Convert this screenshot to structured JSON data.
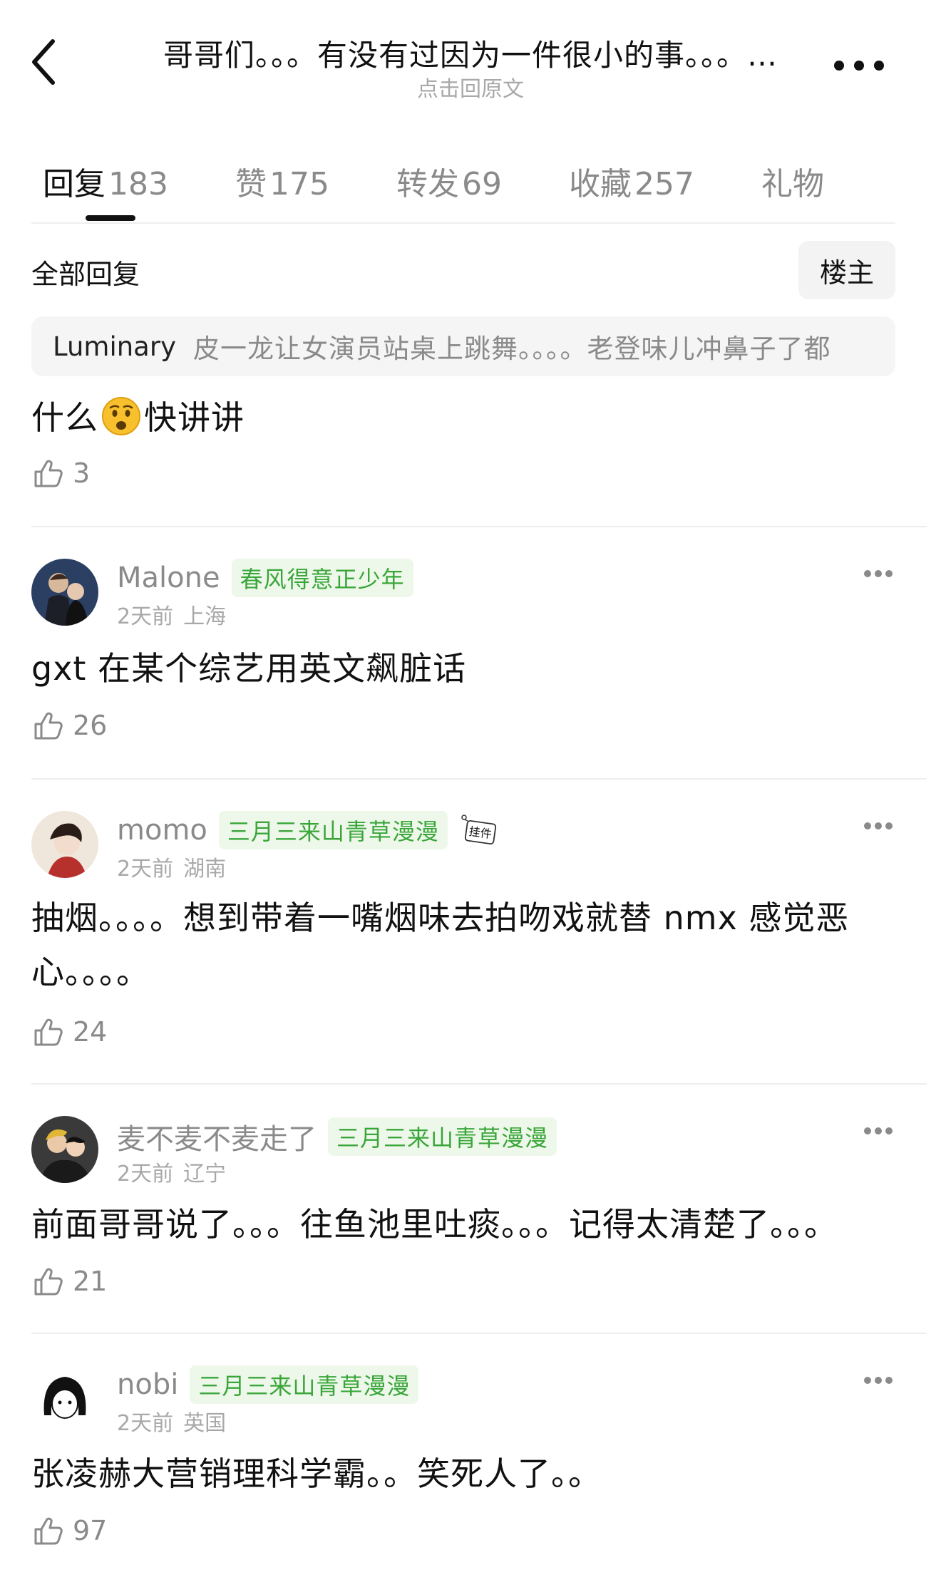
{
  "header": {
    "title": "哥哥们。。。有没有过因为一件很小的事。。。…",
    "subtitle": "点击回原文"
  },
  "tabs": [
    {
      "label": "回复",
      "count": "183",
      "active": true
    },
    {
      "label": "赞",
      "count": "175",
      "active": false
    },
    {
      "label": "转发",
      "count": "69",
      "active": false
    },
    {
      "label": "收藏",
      "count": "257",
      "active": false
    },
    {
      "label": "礼物",
      "count": "",
      "active": false
    }
  ],
  "filter": {
    "all_replies": "全部回复",
    "op_button": "楼主"
  },
  "quoted": {
    "name": "Luminary",
    "text": "皮一龙让女演员站桌上跳舞。。。。老登味儿冲鼻子了都"
  },
  "top_reply": {
    "text_before": "什么",
    "emoji": "worried-face-emoji",
    "text_after": "快讲讲",
    "likes": "3"
  },
  "comments": [
    {
      "name": "Malone",
      "badge": "春风得意正少年",
      "time": "2天前",
      "location": "上海",
      "text": "gxt 在某个综艺用英文飙脏话",
      "likes": "26",
      "has_pendant": false
    },
    {
      "name": "momo",
      "badge": "三月三来山青草漫漫",
      "time": "2天前",
      "location": "湖南",
      "text": "抽烟。。。。想到带着一嘴烟味去拍吻戏就替 nmx 感觉恶心。。。。",
      "likes": "24",
      "has_pendant": true,
      "pendant_label": "挂件"
    },
    {
      "name": "麦不麦不麦走了",
      "badge": "三月三来山青草漫漫",
      "time": "2天前",
      "location": "辽宁",
      "text": "前面哥哥说了。。。往鱼池里吐痰。。。记得太清楚了。。。",
      "likes": "21",
      "has_pendant": false
    },
    {
      "name": "nobi",
      "badge": "三月三来山青草漫漫",
      "time": "2天前",
      "location": "英国",
      "text": "张凌赫大营销理科学霸。。笑死人了。。",
      "likes": "97",
      "has_pendant": false
    }
  ],
  "colors": {
    "badge_text": "#3aa63a",
    "badge_bg": "#eef8ea",
    "muted": "#8a8a8a",
    "divider": "#eeeeee"
  }
}
